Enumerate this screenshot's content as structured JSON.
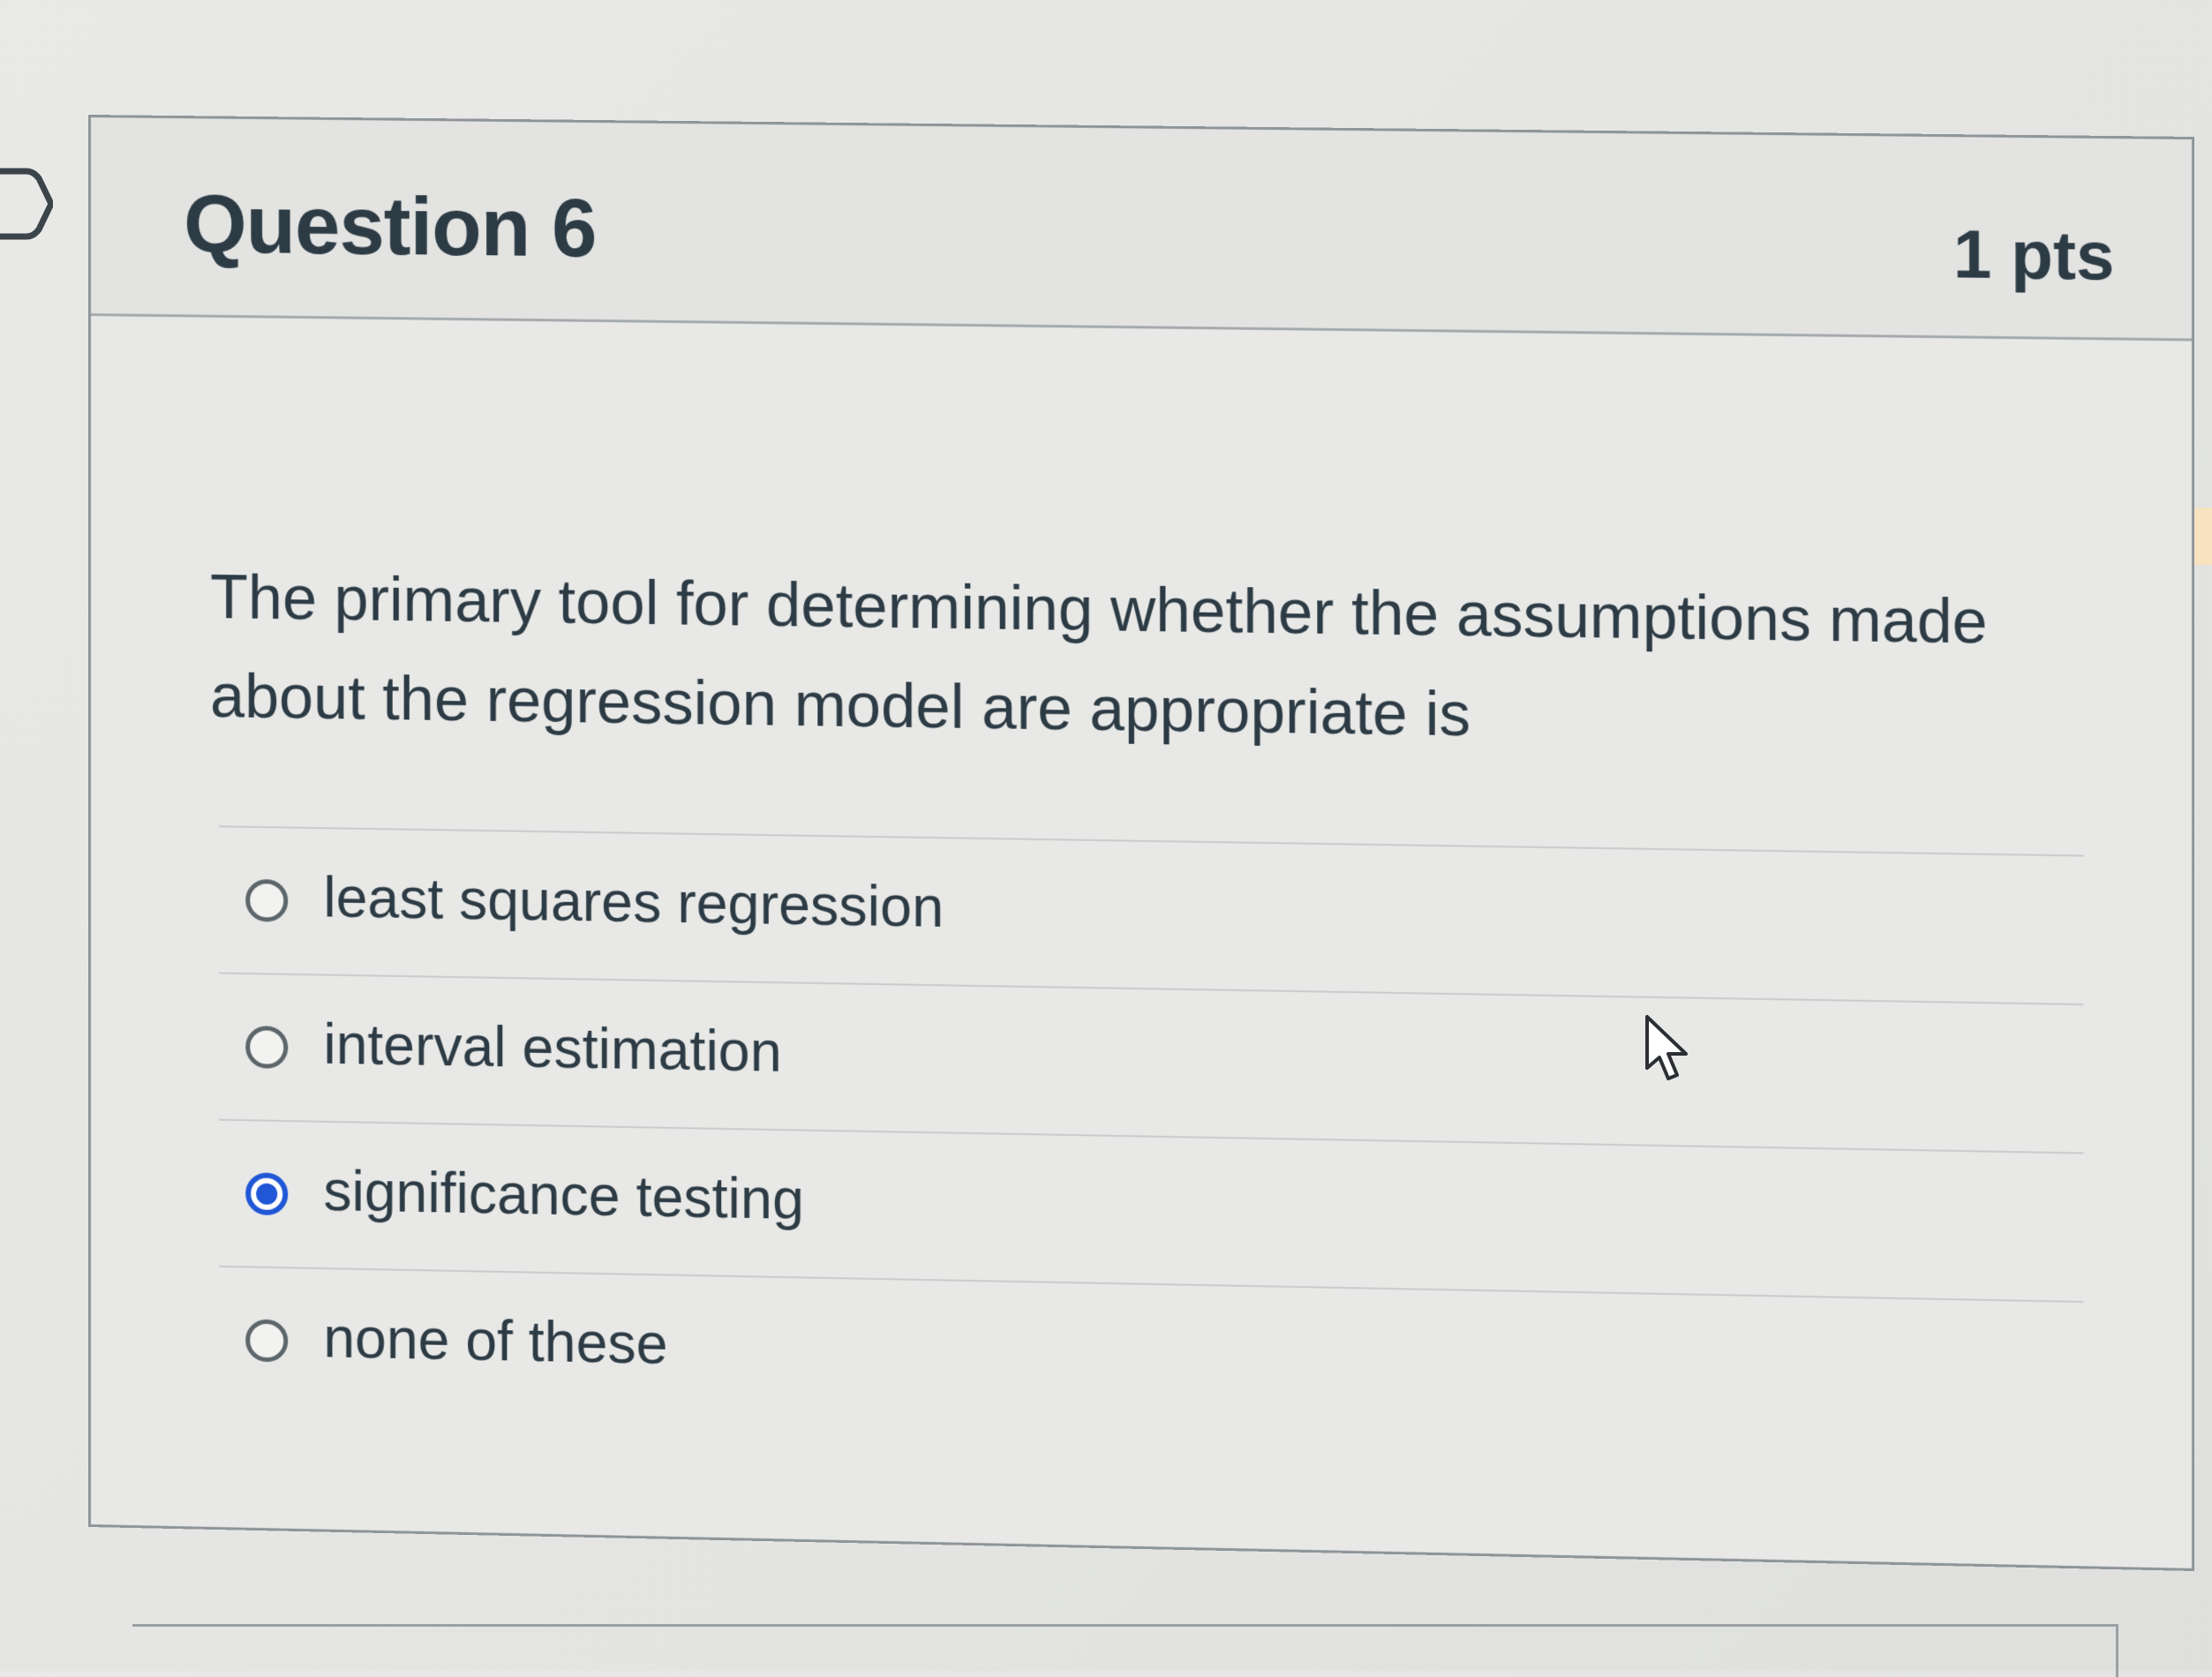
{
  "question": {
    "title": "Question 6",
    "points": "1 pts",
    "text": "The primary tool for determining whether the assumptions made about the regression model are appropriate is"
  },
  "answers": [
    {
      "label": "least squares regression",
      "selected": false
    },
    {
      "label": "interval estimation",
      "selected": false
    },
    {
      "label": "significance testing",
      "selected": true
    },
    {
      "label": "none of these",
      "selected": false
    }
  ],
  "colors": {
    "selected_radio": "#1f57d6",
    "text": "#2d3b45",
    "border": "#8e9599"
  },
  "icons": {
    "flag": "flag-marker-icon",
    "cursor": "mouse-pointer-icon"
  }
}
